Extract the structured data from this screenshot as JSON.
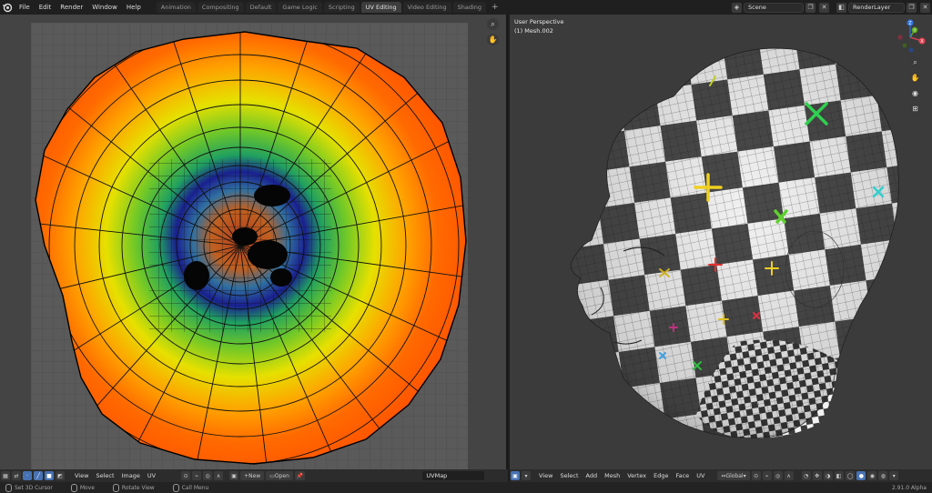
{
  "topbar": {
    "menus": [
      "File",
      "Edit",
      "Render",
      "Window",
      "Help"
    ],
    "tabs": [
      {
        "label": "Animation",
        "active": false
      },
      {
        "label": "Compositing",
        "active": false
      },
      {
        "label": "Default",
        "active": false
      },
      {
        "label": "Game Logic",
        "active": false
      },
      {
        "label": "Scripting",
        "active": false
      },
      {
        "label": "UV Editing",
        "active": true
      },
      {
        "label": "Video Editing",
        "active": false
      },
      {
        "label": "Shading",
        "active": false
      }
    ],
    "add_tab_symbol": "+",
    "scene_name": "Scene",
    "render_layer": "RenderLayer"
  },
  "viewport": {
    "perspective_label": "User Perspective",
    "object_label": "(1) Mesh.002",
    "axes": {
      "x": "X",
      "y": "Y",
      "z": "Z"
    }
  },
  "uv_header": {
    "menus": [
      "View",
      "Select",
      "Image",
      "UV"
    ],
    "new_label": "New",
    "open_label": "Open",
    "uvmap_name": "UVMap"
  },
  "vp_header": {
    "menus": [
      "View",
      "Select",
      "Add",
      "Mesh",
      "Vertex",
      "Edge",
      "Face",
      "UV"
    ],
    "transform_orientation": "Global"
  },
  "statusbar": {
    "hints": [
      {
        "label": "Set 3D Cursor"
      },
      {
        "label": "Move"
      },
      {
        "label": "Rotate View"
      },
      {
        "label": "Call Menu"
      }
    ],
    "version": "2.91.0 Alpha"
  },
  "colors": {
    "accent": "#4772b3",
    "active_tab": "#3d3d3d",
    "uv_orange": "#ff5a00",
    "uv_yellow": "#e6e600",
    "uv_green": "#30c030",
    "uv_blue": "#102090"
  }
}
